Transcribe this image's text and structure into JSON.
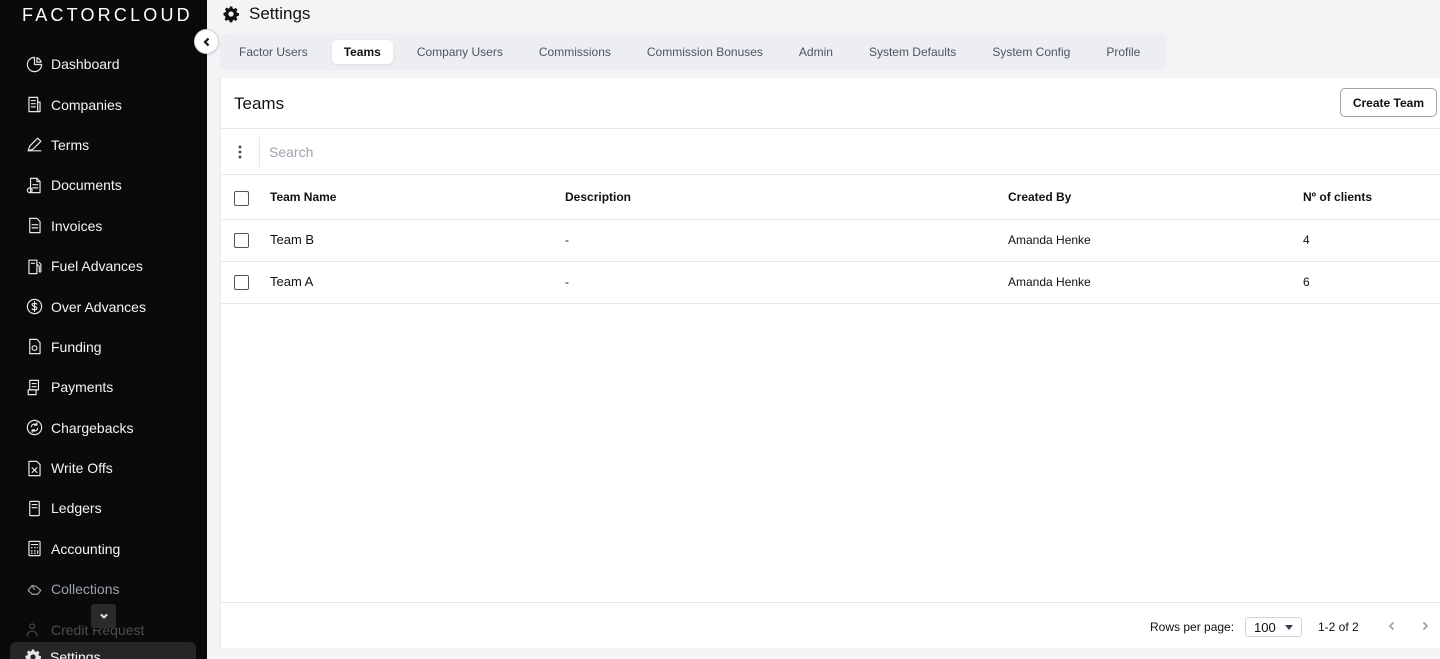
{
  "app": {
    "logo": "FACTORCLOUD"
  },
  "sidebar": {
    "items": [
      {
        "label": "Dashboard",
        "icon": "dashboard-icon"
      },
      {
        "label": "Companies",
        "icon": "building-icon"
      },
      {
        "label": "Terms",
        "icon": "pen-icon"
      },
      {
        "label": "Documents",
        "icon": "documents-icon"
      },
      {
        "label": "Invoices",
        "icon": "invoice-icon"
      },
      {
        "label": "Fuel Advances",
        "icon": "fuel-icon"
      },
      {
        "label": "Over Advances",
        "icon": "dollar-circle-icon"
      },
      {
        "label": "Funding",
        "icon": "funding-icon"
      },
      {
        "label": "Payments",
        "icon": "payments-icon"
      },
      {
        "label": "Chargebacks",
        "icon": "chargeback-icon"
      },
      {
        "label": "Write Offs",
        "icon": "write-off-icon"
      },
      {
        "label": "Ledgers",
        "icon": "ledger-icon"
      },
      {
        "label": "Accounting",
        "icon": "calculator-icon"
      },
      {
        "label": "Collections",
        "icon": "collections-icon"
      },
      {
        "label": "Credit Request",
        "icon": "credit-request-icon"
      }
    ],
    "active": {
      "label": "Settings",
      "icon": "gear-icon"
    }
  },
  "header": {
    "title": "Settings",
    "icon": "gear-icon"
  },
  "tabs": [
    {
      "label": "Factor Users"
    },
    {
      "label": "Teams",
      "active": true
    },
    {
      "label": "Company Users"
    },
    {
      "label": "Commissions"
    },
    {
      "label": "Commission Bonuses"
    },
    {
      "label": "Admin"
    },
    {
      "label": "System Defaults"
    },
    {
      "label": "System Config"
    },
    {
      "label": "Profile"
    }
  ],
  "card": {
    "title": "Teams",
    "create_label": "Create Team",
    "search_placeholder": "Search"
  },
  "table": {
    "columns": [
      "Team Name",
      "Description",
      "Created By",
      "Nº of clients"
    ],
    "rows": [
      {
        "name": "Team B",
        "description": "-",
        "created_by": "Amanda Henke",
        "clients": "4"
      },
      {
        "name": "Team A",
        "description": "-",
        "created_by": "Amanda Henke",
        "clients": "6"
      }
    ]
  },
  "pagination": {
    "rows_per_page_label": "Rows per page:",
    "rows_per_page": "100",
    "range": "1-2 of 2"
  }
}
